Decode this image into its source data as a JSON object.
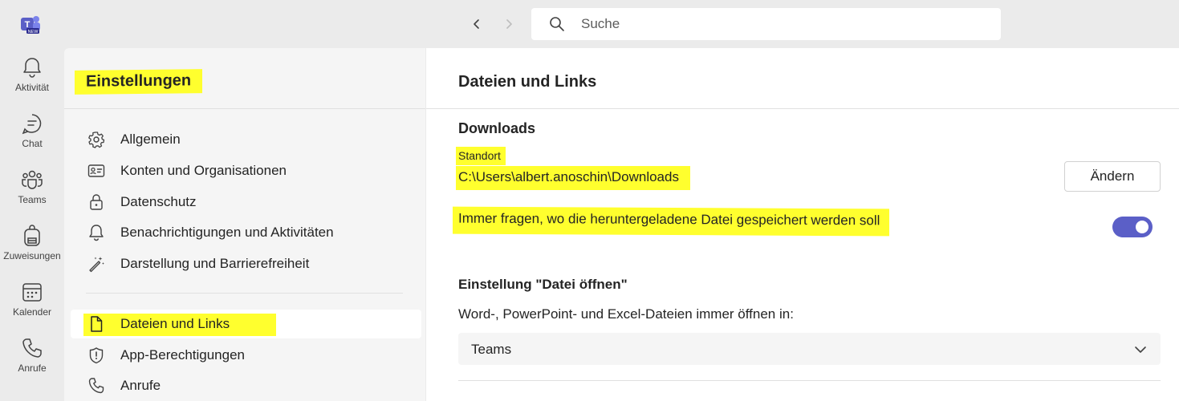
{
  "search": {
    "placeholder": "Suche"
  },
  "rail": {
    "items": [
      {
        "label": "Aktivität",
        "icon": "bell-icon"
      },
      {
        "label": "Chat",
        "icon": "chat-icon"
      },
      {
        "label": "Teams",
        "icon": "teams-icon"
      },
      {
        "label": "Zuweisungen",
        "icon": "backpack-icon"
      },
      {
        "label": "Kalender",
        "icon": "calendar-icon"
      },
      {
        "label": "Anrufe",
        "icon": "phone-icon"
      }
    ]
  },
  "settings": {
    "title": "Einstellungen",
    "items": [
      {
        "label": "Allgemein",
        "icon": "gear-icon"
      },
      {
        "label": "Konten und Organisationen",
        "icon": "id-card-icon"
      },
      {
        "label": "Datenschutz",
        "icon": "lock-icon"
      },
      {
        "label": "Benachrichtigungen und Aktivitäten",
        "icon": "bell-icon"
      },
      {
        "label": "Darstellung und Barrierefreiheit",
        "icon": "magic-wand-icon"
      },
      {
        "label": "Dateien und Links",
        "icon": "document-icon",
        "active": true
      },
      {
        "label": "App-Berechtigungen",
        "icon": "shield-icon"
      },
      {
        "label": "Anrufe",
        "icon": "phone-icon"
      }
    ]
  },
  "main": {
    "title": "Dateien und Links",
    "downloads": {
      "heading": "Downloads",
      "location_label": "Standort",
      "location_value": "C:\\Users\\albert.anoschin\\Downloads",
      "change_button": "Ändern",
      "always_ask_label": "Immer fragen, wo die heruntergeladene Datei gespeichert werden soll",
      "always_ask_on": true
    },
    "open_file": {
      "heading": "Einstellung \"Datei öffnen\"",
      "description": "Word-, PowerPoint- und Excel-Dateien immer öffnen in:",
      "selected": "Teams"
    }
  },
  "colors": {
    "accent": "#5b5fc7",
    "highlight": "#ffff2e",
    "rail_bg": "#ebebeb",
    "nav_bg": "#f5f5f5"
  }
}
